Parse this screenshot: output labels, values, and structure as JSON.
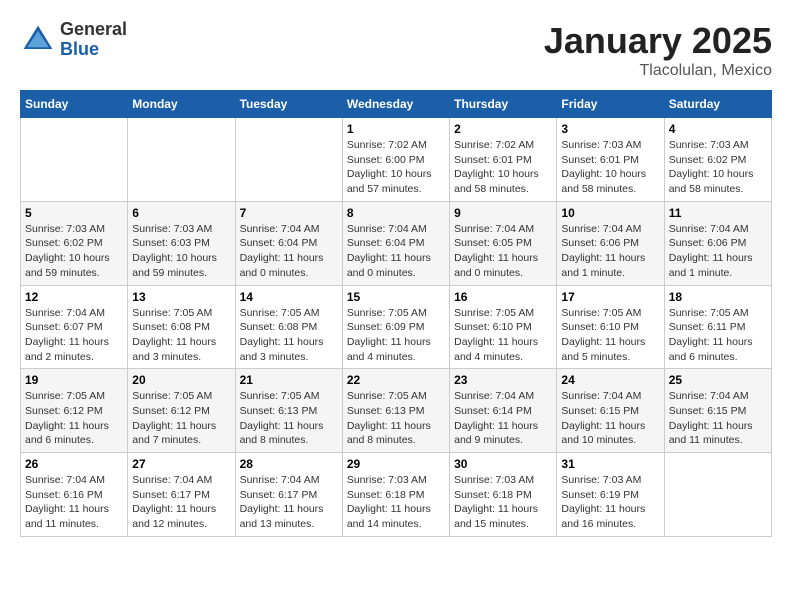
{
  "header": {
    "logo": {
      "general": "General",
      "blue": "Blue"
    },
    "title": "January 2025",
    "location": "Tlacolulan, Mexico"
  },
  "weekdays": [
    "Sunday",
    "Monday",
    "Tuesday",
    "Wednesday",
    "Thursday",
    "Friday",
    "Saturday"
  ],
  "weeks": [
    [
      {
        "day": null,
        "info": null
      },
      {
        "day": null,
        "info": null
      },
      {
        "day": null,
        "info": null
      },
      {
        "day": "1",
        "info": "Sunrise: 7:02 AM\nSunset: 6:00 PM\nDaylight: 10 hours\nand 57 minutes."
      },
      {
        "day": "2",
        "info": "Sunrise: 7:02 AM\nSunset: 6:01 PM\nDaylight: 10 hours\nand 58 minutes."
      },
      {
        "day": "3",
        "info": "Sunrise: 7:03 AM\nSunset: 6:01 PM\nDaylight: 10 hours\nand 58 minutes."
      },
      {
        "day": "4",
        "info": "Sunrise: 7:03 AM\nSunset: 6:02 PM\nDaylight: 10 hours\nand 58 minutes."
      }
    ],
    [
      {
        "day": "5",
        "info": "Sunrise: 7:03 AM\nSunset: 6:02 PM\nDaylight: 10 hours\nand 59 minutes."
      },
      {
        "day": "6",
        "info": "Sunrise: 7:03 AM\nSunset: 6:03 PM\nDaylight: 10 hours\nand 59 minutes."
      },
      {
        "day": "7",
        "info": "Sunrise: 7:04 AM\nSunset: 6:04 PM\nDaylight: 11 hours\nand 0 minutes."
      },
      {
        "day": "8",
        "info": "Sunrise: 7:04 AM\nSunset: 6:04 PM\nDaylight: 11 hours\nand 0 minutes."
      },
      {
        "day": "9",
        "info": "Sunrise: 7:04 AM\nSunset: 6:05 PM\nDaylight: 11 hours\nand 0 minutes."
      },
      {
        "day": "10",
        "info": "Sunrise: 7:04 AM\nSunset: 6:06 PM\nDaylight: 11 hours\nand 1 minute."
      },
      {
        "day": "11",
        "info": "Sunrise: 7:04 AM\nSunset: 6:06 PM\nDaylight: 11 hours\nand 1 minute."
      }
    ],
    [
      {
        "day": "12",
        "info": "Sunrise: 7:04 AM\nSunset: 6:07 PM\nDaylight: 11 hours\nand 2 minutes."
      },
      {
        "day": "13",
        "info": "Sunrise: 7:05 AM\nSunset: 6:08 PM\nDaylight: 11 hours\nand 3 minutes."
      },
      {
        "day": "14",
        "info": "Sunrise: 7:05 AM\nSunset: 6:08 PM\nDaylight: 11 hours\nand 3 minutes."
      },
      {
        "day": "15",
        "info": "Sunrise: 7:05 AM\nSunset: 6:09 PM\nDaylight: 11 hours\nand 4 minutes."
      },
      {
        "day": "16",
        "info": "Sunrise: 7:05 AM\nSunset: 6:10 PM\nDaylight: 11 hours\nand 4 minutes."
      },
      {
        "day": "17",
        "info": "Sunrise: 7:05 AM\nSunset: 6:10 PM\nDaylight: 11 hours\nand 5 minutes."
      },
      {
        "day": "18",
        "info": "Sunrise: 7:05 AM\nSunset: 6:11 PM\nDaylight: 11 hours\nand 6 minutes."
      }
    ],
    [
      {
        "day": "19",
        "info": "Sunrise: 7:05 AM\nSunset: 6:12 PM\nDaylight: 11 hours\nand 6 minutes."
      },
      {
        "day": "20",
        "info": "Sunrise: 7:05 AM\nSunset: 6:12 PM\nDaylight: 11 hours\nand 7 minutes."
      },
      {
        "day": "21",
        "info": "Sunrise: 7:05 AM\nSunset: 6:13 PM\nDaylight: 11 hours\nand 8 minutes."
      },
      {
        "day": "22",
        "info": "Sunrise: 7:05 AM\nSunset: 6:13 PM\nDaylight: 11 hours\nand 8 minutes."
      },
      {
        "day": "23",
        "info": "Sunrise: 7:04 AM\nSunset: 6:14 PM\nDaylight: 11 hours\nand 9 minutes."
      },
      {
        "day": "24",
        "info": "Sunrise: 7:04 AM\nSunset: 6:15 PM\nDaylight: 11 hours\nand 10 minutes."
      },
      {
        "day": "25",
        "info": "Sunrise: 7:04 AM\nSunset: 6:15 PM\nDaylight: 11 hours\nand 11 minutes."
      }
    ],
    [
      {
        "day": "26",
        "info": "Sunrise: 7:04 AM\nSunset: 6:16 PM\nDaylight: 11 hours\nand 11 minutes."
      },
      {
        "day": "27",
        "info": "Sunrise: 7:04 AM\nSunset: 6:17 PM\nDaylight: 11 hours\nand 12 minutes."
      },
      {
        "day": "28",
        "info": "Sunrise: 7:04 AM\nSunset: 6:17 PM\nDaylight: 11 hours\nand 13 minutes."
      },
      {
        "day": "29",
        "info": "Sunrise: 7:03 AM\nSunset: 6:18 PM\nDaylight: 11 hours\nand 14 minutes."
      },
      {
        "day": "30",
        "info": "Sunrise: 7:03 AM\nSunset: 6:18 PM\nDaylight: 11 hours\nand 15 minutes."
      },
      {
        "day": "31",
        "info": "Sunrise: 7:03 AM\nSunset: 6:19 PM\nDaylight: 11 hours\nand 16 minutes."
      },
      {
        "day": null,
        "info": null
      }
    ]
  ]
}
